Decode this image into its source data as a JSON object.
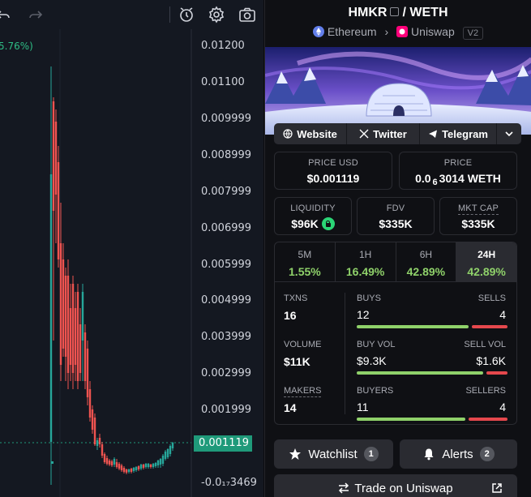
{
  "chart": {
    "pct_label": "5.76%)",
    "y_ticks": [
      "0.01200",
      "0.01100",
      "0.009999",
      "0.008999",
      "0.007999",
      "0.006999",
      "0.005999",
      "0.004999",
      "0.003999",
      "0.002999",
      "0.001999"
    ],
    "price_tag": "0.001119",
    "bottom_tick": "-0.0₁₇3469",
    "colors": {
      "up": "#26a69a",
      "down": "#ef5350",
      "background": "#141821"
    },
    "icons": [
      "undo-icon",
      "redo-icon",
      "alert-icon",
      "gear-icon",
      "camera-icon"
    ]
  },
  "pair": {
    "base": "HMKR",
    "separator": "/",
    "quote": "WETH",
    "chain": "Ethereum",
    "dex": "Uniswap",
    "version": "V2"
  },
  "socials": {
    "website": "Website",
    "twitter": "Twitter",
    "telegram": "Telegram"
  },
  "price": {
    "usd_label": "PRICE USD",
    "usd_value": "$0.001119",
    "native_label": "PRICE",
    "native_prefix": "0.0",
    "native_zeros": "6",
    "native_suffix": "3014 WETH"
  },
  "metrics": {
    "liquidity_label": "LIQUIDITY",
    "liquidity_value": "$96K",
    "fdv_label": "FDV",
    "fdv_value": "$335K",
    "mcap_label": "MKT CAP",
    "mcap_value": "$335K"
  },
  "timeframes": [
    {
      "label": "5M",
      "value": "1.55%"
    },
    {
      "label": "1H",
      "value": "16.49%"
    },
    {
      "label": "6H",
      "value": "42.89%"
    },
    {
      "label": "24H",
      "value": "42.89%"
    }
  ],
  "stats": {
    "txns_label": "TXNS",
    "txns_value": "16",
    "buys_label": "BUYS",
    "buys_value": "12",
    "sells_label": "SELLS",
    "sells_value": "4",
    "volume_label": "VOLUME",
    "volume_value": "$11K",
    "buy_vol_label": "BUY VOL",
    "buy_vol_value": "$9.3K",
    "sell_vol_label": "SELL VOL",
    "sell_vol_value": "$1.6K",
    "makers_label": "MAKERS",
    "makers_value": "14",
    "buyers_label": "BUYERS",
    "buyers_value": "11",
    "sellers_label": "SELLERS",
    "sellers_value": "4",
    "buys_fraction": 0.75,
    "buy_vol_fraction": 0.85,
    "buyers_fraction": 0.73
  },
  "actions": {
    "watchlist_label": "Watchlist",
    "watchlist_count": "1",
    "alerts_label": "Alerts",
    "alerts_count": "2",
    "trade_label": "Trade on Uniswap"
  }
}
